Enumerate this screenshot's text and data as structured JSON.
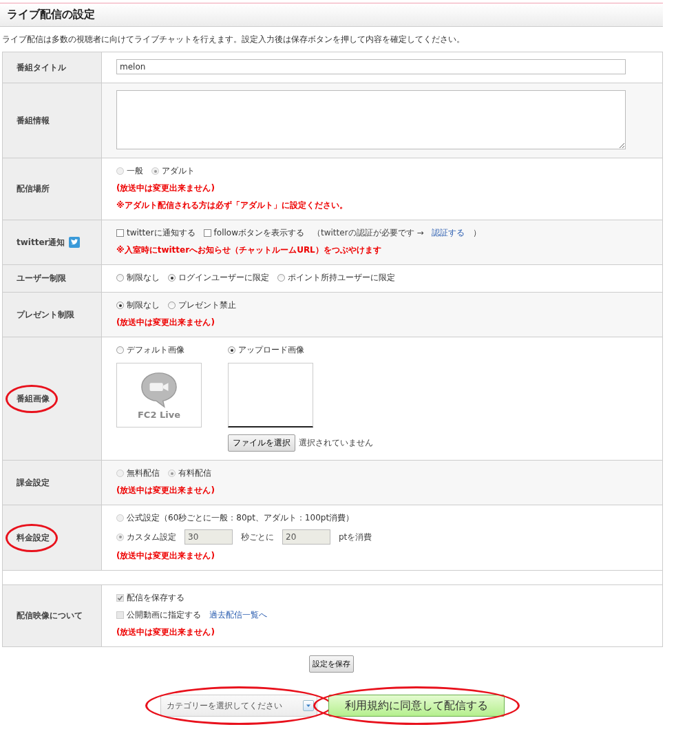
{
  "page": {
    "title": "ライブ配信の設定",
    "intro": "ライブ配信は多数の視聴者に向けてライブチャットを行えます。設定入力後は保存ボタンを押して内容を確定してください。"
  },
  "rows": [
    {
      "kind": "field",
      "label": "番組タイトル",
      "lines": [
        [
          {
            "kind": "input",
            "value": "melon",
            "wide": true,
            "disabled": false
          }
        ]
      ]
    },
    {
      "kind": "field",
      "label": "番組情報",
      "lines": [
        [
          {
            "kind": "textarea"
          }
        ]
      ]
    },
    {
      "kind": "field",
      "label": "配信場所",
      "lines": [
        [
          {
            "kind": "radio",
            "label": "一般",
            "selected": false,
            "disabled": true
          },
          {
            "kind": "radio",
            "label": "アダルト",
            "selected": true,
            "disabled": true
          }
        ],
        [
          {
            "kind": "note",
            "text": "(放送中は変更出来ません)"
          }
        ],
        [
          {
            "kind": "note",
            "text": "※アダルト配信される方は必ず「アダルト」に設定ください。"
          }
        ]
      ]
    },
    {
      "kind": "field",
      "label": "twitter通知",
      "twitter_icon": true,
      "lines": [
        [
          {
            "kind": "checkbox",
            "label": "twitterに通知する",
            "checked": false,
            "disabled": false
          },
          {
            "kind": "checkbox",
            "label": "followボタンを表示する",
            "checked": false,
            "disabled": false
          },
          {
            "kind": "text",
            "text": "（twitterの認証が必要です →"
          },
          {
            "kind": "link",
            "text": "認証する"
          },
          {
            "kind": "text",
            "text": "）"
          }
        ],
        [
          {
            "kind": "note",
            "text": "※入室時にtwitterへお知らせ（チャットルームURL）をつぶやけます"
          }
        ]
      ]
    },
    {
      "kind": "field",
      "label": "ユーザー制限",
      "lines": [
        [
          {
            "kind": "radio",
            "label": "制限なし",
            "selected": false,
            "disabled": false
          },
          {
            "kind": "radio",
            "label": "ログインユーザーに限定",
            "selected": true,
            "disabled": false
          },
          {
            "kind": "radio",
            "label": "ポイント所持ユーザーに限定",
            "selected": false,
            "disabled": false
          }
        ]
      ]
    },
    {
      "kind": "field",
      "label": "プレゼント制限",
      "lines": [
        [
          {
            "kind": "radio",
            "label": "制限なし",
            "selected": true,
            "disabled": false
          },
          {
            "kind": "radio",
            "label": "プレゼント禁止",
            "selected": false,
            "disabled": false
          }
        ],
        [
          {
            "kind": "note",
            "text": "(放送中は変更出来ません)"
          }
        ]
      ]
    },
    {
      "kind": "field",
      "label": "番組画像",
      "circled": true,
      "lines": [
        [
          {
            "kind": "default_image",
            "label": "デフォルト画像",
            "selected": false,
            "caption": "FC2 Live"
          },
          {
            "kind": "upload_image",
            "label": "アップロード画像",
            "selected": true,
            "file_button": "ファイルを選択",
            "file_status": "選択されていません"
          }
        ]
      ]
    },
    {
      "kind": "field",
      "label": "課金設定",
      "lines": [
        [
          {
            "kind": "radio",
            "label": "無料配信",
            "selected": false,
            "disabled": true
          },
          {
            "kind": "radio",
            "label": "有料配信",
            "selected": true,
            "disabled": true
          }
        ],
        [
          {
            "kind": "note",
            "text": "(放送中は変更出来ません)"
          }
        ]
      ]
    },
    {
      "kind": "field",
      "label": "料金設定",
      "circled": true,
      "lines": [
        [
          {
            "kind": "radio",
            "label": "公式設定（60秒ごとに一般：80pt、アダルト：100pt消費）",
            "selected": false,
            "disabled": true
          }
        ],
        [
          {
            "kind": "radio",
            "label": "カスタム設定",
            "selected": true,
            "disabled": true
          },
          {
            "kind": "input",
            "value": "30",
            "wide": false,
            "disabled": true
          },
          {
            "kind": "text",
            "text": "秒ごとに"
          },
          {
            "kind": "input",
            "value": "20",
            "wide": false,
            "disabled": true
          },
          {
            "kind": "text",
            "text": "ptを消費"
          }
        ],
        [
          {
            "kind": "note",
            "text": "(放送中は変更出来ません)"
          }
        ]
      ]
    },
    {
      "kind": "spacer"
    },
    {
      "kind": "field",
      "label": "配信映像について",
      "lines": [
        [
          {
            "kind": "checkbox",
            "label": "配信を保存する",
            "checked": true,
            "disabled": true
          }
        ],
        [
          {
            "kind": "checkbox",
            "label": "公開動画に指定する",
            "checked": false,
            "disabled": true
          },
          {
            "kind": "link",
            "text": "過去配信一覧へ"
          }
        ],
        [
          {
            "kind": "note",
            "text": "(放送中は変更出来ません)"
          }
        ]
      ]
    }
  ],
  "save_button": "設定を保存",
  "category_select": {
    "placeholder": "カテゴリーを選択してください",
    "circled": true
  },
  "start_button": {
    "label": "利用規約に同意して配信する",
    "circled": true
  }
}
